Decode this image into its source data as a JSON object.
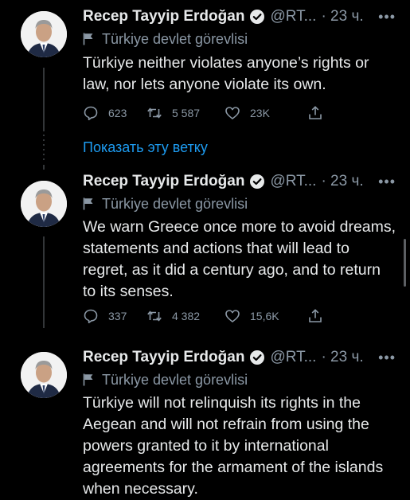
{
  "author": {
    "name": "Recep Tayyip Erdoğan",
    "handle": "@RT...",
    "label": "Türkiye devlet görevlisi"
  },
  "show_thread": "Показать эту ветку",
  "tweets": [
    {
      "time": "· 23 ч.",
      "text": "Türkiye neither violates anyone’s rights or law, nor lets anyone violate its own.",
      "replies": "623",
      "retweets": "5 587",
      "likes": "23K"
    },
    {
      "time": "· 23 ч.",
      "text": "We warn Greece once more to avoid dreams, statements and actions that will lead to regret, as it did a century ago, and to return to its senses.",
      "replies": "337",
      "retweets": "4 382",
      "likes": "15,6K"
    },
    {
      "time": "· 23 ч.",
      "text": "Türkiye will not relinquish its rights in the Aegean and will not refrain from using the powers granted to it by international agreements for the armament of the islands when necessary."
    }
  ],
  "icons": {
    "verified": "verified-badge-icon",
    "label": "flag-icon",
    "reply": "reply-icon",
    "retweet": "retweet-icon",
    "like": "heart-icon",
    "share": "share-icon",
    "more": "more-icon"
  },
  "colors": {
    "background": "#000000",
    "text": "#e7e9ea",
    "muted": "#8b98a5",
    "link": "#1d9bf0"
  }
}
